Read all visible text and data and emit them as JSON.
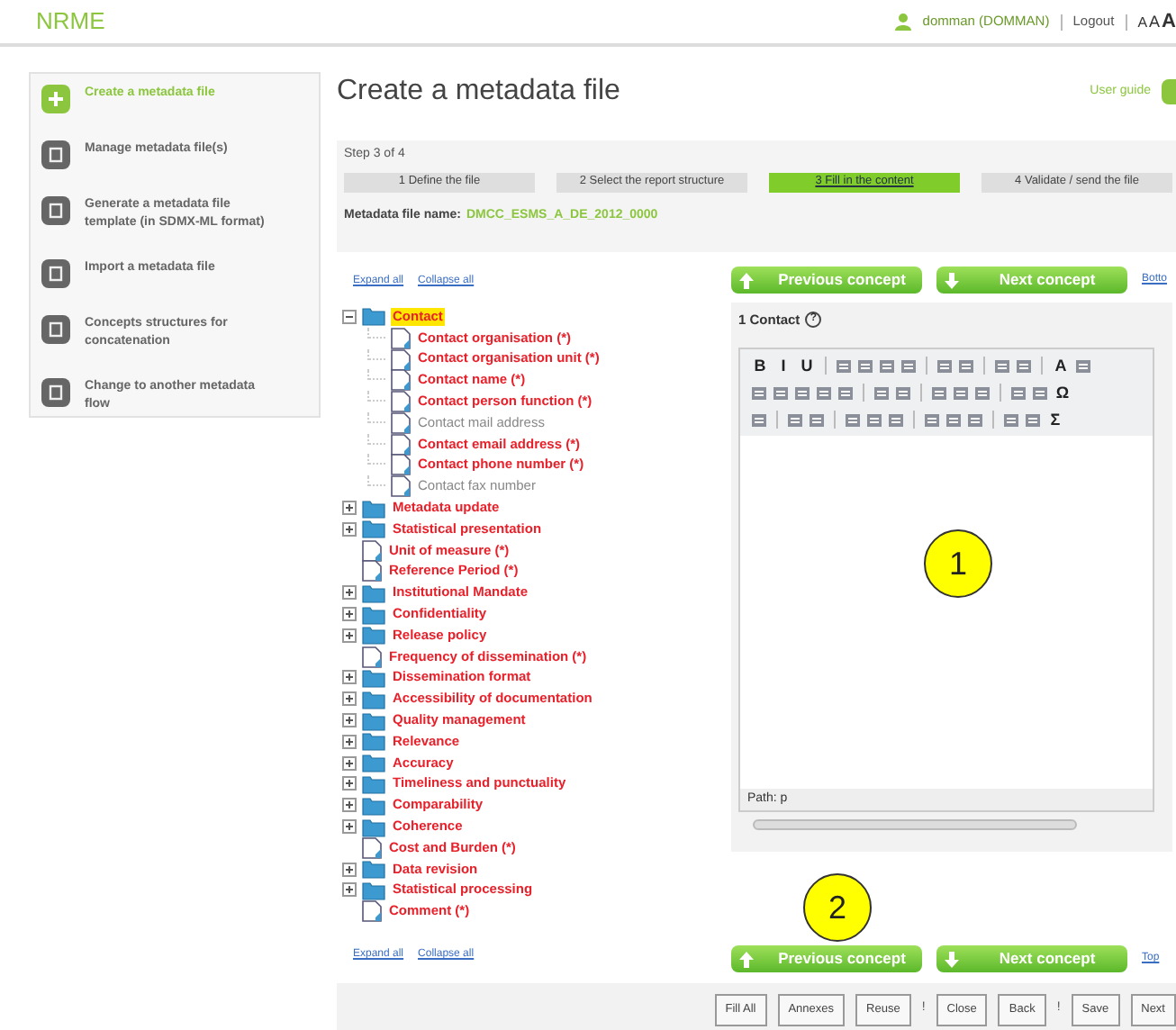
{
  "header": {
    "logo": "NRME",
    "user": "domman (DOMMAN)",
    "logout": "Logout",
    "font_sizes": [
      "A",
      "A",
      "A"
    ]
  },
  "sidebar": {
    "items": [
      {
        "label": "Create a metadata file",
        "selected": true
      },
      {
        "label": "Manage metadata file(s)",
        "selected": false
      },
      {
        "label": "Generate a metadata file template (in SDMX-ML format)",
        "selected": false
      },
      {
        "label": "Import a metadata file",
        "selected": false
      },
      {
        "label": "Concepts structures for concatenation",
        "selected": false
      },
      {
        "label": "Change to another metadata flow",
        "selected": false
      }
    ]
  },
  "page": {
    "title": "Create a metadata file",
    "user_guide": "User guide"
  },
  "wizard": {
    "step_label": "Step 3 of 4",
    "steps": [
      {
        "label": "1 Define the file",
        "selected": false
      },
      {
        "label": "2 Select the report structure",
        "selected": false
      },
      {
        "label": "3 Fill in the content",
        "selected": true
      },
      {
        "label": "4 Validate / send the file",
        "selected": false
      }
    ],
    "file_name_label": "Metadata file name:",
    "file_name": "DMCC_ESMS_A_DE_2012_0000"
  },
  "tree": {
    "expand_all": "Expand all",
    "collapse_all": "Collapse all",
    "expand_all_bottom": "Expand all",
    "collapse_all_bottom": "Collapse all",
    "items": [
      {
        "label": "Contact",
        "kind": "folder",
        "required": true,
        "selected": true,
        "expanded": true,
        "children": [
          {
            "label": "Contact organisation (*)",
            "kind": "file",
            "required": true,
            "selected": false
          },
          {
            "label": "Contact organisation unit (*)",
            "kind": "file",
            "required": true,
            "selected": false
          },
          {
            "label": "Contact name (*)",
            "kind": "file",
            "required": true,
            "selected": false
          },
          {
            "label": "Contact person function (*)",
            "kind": "file",
            "required": true,
            "selected": false
          },
          {
            "label": "Contact mail address",
            "kind": "file",
            "required": false,
            "selected": false
          },
          {
            "label": "Contact email address (*)",
            "kind": "file",
            "required": true,
            "selected": false
          },
          {
            "label": "Contact phone number (*)",
            "kind": "file",
            "required": true,
            "selected": false
          },
          {
            "label": "Contact fax number",
            "kind": "file",
            "required": false,
            "selected": false
          }
        ]
      },
      {
        "label": "Metadata update",
        "kind": "folder",
        "required": true,
        "selected": false,
        "expanded": false
      },
      {
        "label": "Statistical presentation",
        "kind": "folder",
        "required": true,
        "selected": false,
        "expanded": false
      },
      {
        "label": "Unit of measure (*)",
        "kind": "file",
        "required": true,
        "selected": false
      },
      {
        "label": "Reference Period (*)",
        "kind": "file",
        "required": true,
        "selected": false
      },
      {
        "label": "Institutional Mandate",
        "kind": "folder",
        "required": true,
        "selected": false,
        "expanded": false
      },
      {
        "label": "Confidentiality",
        "kind": "folder",
        "required": true,
        "selected": false,
        "expanded": false
      },
      {
        "label": "Release policy",
        "kind": "folder",
        "required": true,
        "selected": false,
        "expanded": false
      },
      {
        "label": "Frequency of dissemination (*)",
        "kind": "file",
        "required": true,
        "selected": false
      },
      {
        "label": "Dissemination format",
        "kind": "folder",
        "required": true,
        "selected": false,
        "expanded": false
      },
      {
        "label": "Accessibility of documentation",
        "kind": "folder",
        "required": true,
        "selected": false,
        "expanded": false
      },
      {
        "label": "Quality management",
        "kind": "folder",
        "required": true,
        "selected": false,
        "expanded": false
      },
      {
        "label": "Relevance",
        "kind": "folder",
        "required": true,
        "selected": false,
        "expanded": false
      },
      {
        "label": "Accuracy",
        "kind": "folder",
        "required": true,
        "selected": false,
        "expanded": false
      },
      {
        "label": "Timeliness and punctuality",
        "kind": "folder",
        "required": true,
        "selected": false,
        "expanded": false
      },
      {
        "label": "Comparability",
        "kind": "folder",
        "required": true,
        "selected": false,
        "expanded": false
      },
      {
        "label": "Coherence",
        "kind": "folder",
        "required": true,
        "selected": false,
        "expanded": false
      },
      {
        "label": "Cost and Burden (*)",
        "kind": "file",
        "required": true,
        "selected": false
      },
      {
        "label": "Data revision",
        "kind": "folder",
        "required": true,
        "selected": false,
        "expanded": false
      },
      {
        "label": "Statistical processing",
        "kind": "folder",
        "required": true,
        "selected": false,
        "expanded": false
      },
      {
        "label": "Comment (*)",
        "kind": "file",
        "required": true,
        "selected": false
      }
    ]
  },
  "nav_top": {
    "previous": "Previous concept",
    "next": "Next concept",
    "link": "Botto"
  },
  "editor": {
    "heading": "1 Contact",
    "help": "?",
    "toolbar": [
      [
        {
          "kind": "text",
          "label": "B"
        },
        {
          "kind": "text",
          "label": "I"
        },
        {
          "kind": "text",
          "label": "U"
        },
        {
          "kind": "sep"
        },
        {
          "kind": "icon"
        },
        {
          "kind": "icon"
        },
        {
          "kind": "icon"
        },
        {
          "kind": "icon"
        },
        {
          "kind": "sep"
        },
        {
          "kind": "icon"
        },
        {
          "kind": "icon"
        },
        {
          "kind": "sep"
        },
        {
          "kind": "icon"
        },
        {
          "kind": "icon"
        },
        {
          "kind": "sep"
        },
        {
          "kind": "text",
          "label": "A"
        },
        {
          "kind": "icon"
        }
      ],
      [
        {
          "kind": "icon"
        },
        {
          "kind": "icon"
        },
        {
          "kind": "icon"
        },
        {
          "kind": "icon"
        },
        {
          "kind": "icon"
        },
        {
          "kind": "sep"
        },
        {
          "kind": "icon"
        },
        {
          "kind": "icon"
        },
        {
          "kind": "sep"
        },
        {
          "kind": "icon"
        },
        {
          "kind": "icon"
        },
        {
          "kind": "icon"
        },
        {
          "kind": "sep"
        },
        {
          "kind": "icon"
        },
        {
          "kind": "icon"
        },
        {
          "kind": "text",
          "label": "Ω"
        }
      ],
      [
        {
          "kind": "icon"
        },
        {
          "kind": "sep"
        },
        {
          "kind": "icon"
        },
        {
          "kind": "icon"
        },
        {
          "kind": "sep"
        },
        {
          "kind": "icon"
        },
        {
          "kind": "icon"
        },
        {
          "kind": "icon"
        },
        {
          "kind": "sep"
        },
        {
          "kind": "icon"
        },
        {
          "kind": "icon"
        },
        {
          "kind": "icon"
        },
        {
          "kind": "sep"
        },
        {
          "kind": "icon"
        },
        {
          "kind": "icon"
        },
        {
          "kind": "text",
          "label": "Σ"
        }
      ]
    ],
    "path": "Path: p"
  },
  "nav_bottom": {
    "previous": "Previous concept",
    "next": "Next concept",
    "link": "Top"
  },
  "actions": [
    {
      "label": "Fill All",
      "kind": "button"
    },
    {
      "label": "Annexes",
      "kind": "button"
    },
    {
      "label": "Reuse",
      "kind": "button"
    },
    {
      "kind": "sep",
      "label": "!"
    },
    {
      "label": "Close",
      "kind": "button"
    },
    {
      "label": "Back",
      "kind": "button"
    },
    {
      "kind": "sep",
      "label": "!"
    },
    {
      "label": "Save",
      "kind": "button"
    },
    {
      "label": "Next",
      "kind": "button"
    }
  ],
  "callouts": [
    "1",
    "2"
  ]
}
